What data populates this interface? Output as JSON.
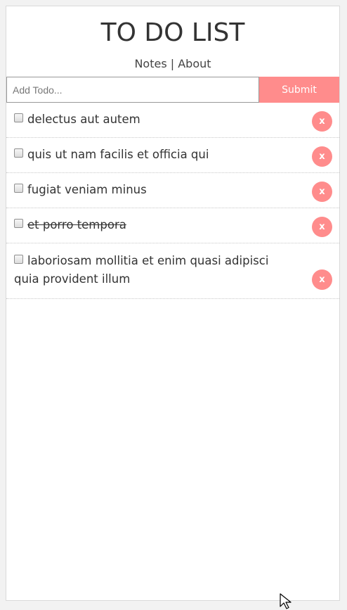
{
  "header": {
    "title": "TO DO LIST",
    "nav": {
      "notes_label": "Notes",
      "separator": "|",
      "about_label": "About"
    }
  },
  "form": {
    "input_placeholder": "Add Todo...",
    "input_value": "",
    "submit_label": "Submit"
  },
  "todos": [
    {
      "text": "delectus aut autem",
      "completed": false,
      "delete_label": "x"
    },
    {
      "text": "quis ut nam facilis et officia qui",
      "completed": false,
      "delete_label": "x"
    },
    {
      "text": "fugiat veniam minus",
      "completed": false,
      "delete_label": "x"
    },
    {
      "text": "et porro tempora",
      "completed": true,
      "delete_label": "x"
    },
    {
      "text": "laboriosam mollitia et enim quasi adipisci quia provident illum",
      "completed": false,
      "delete_label": "x"
    }
  ],
  "colors": {
    "accent": "#ff8c8c",
    "text": "#333333",
    "background": "#ffffff"
  }
}
